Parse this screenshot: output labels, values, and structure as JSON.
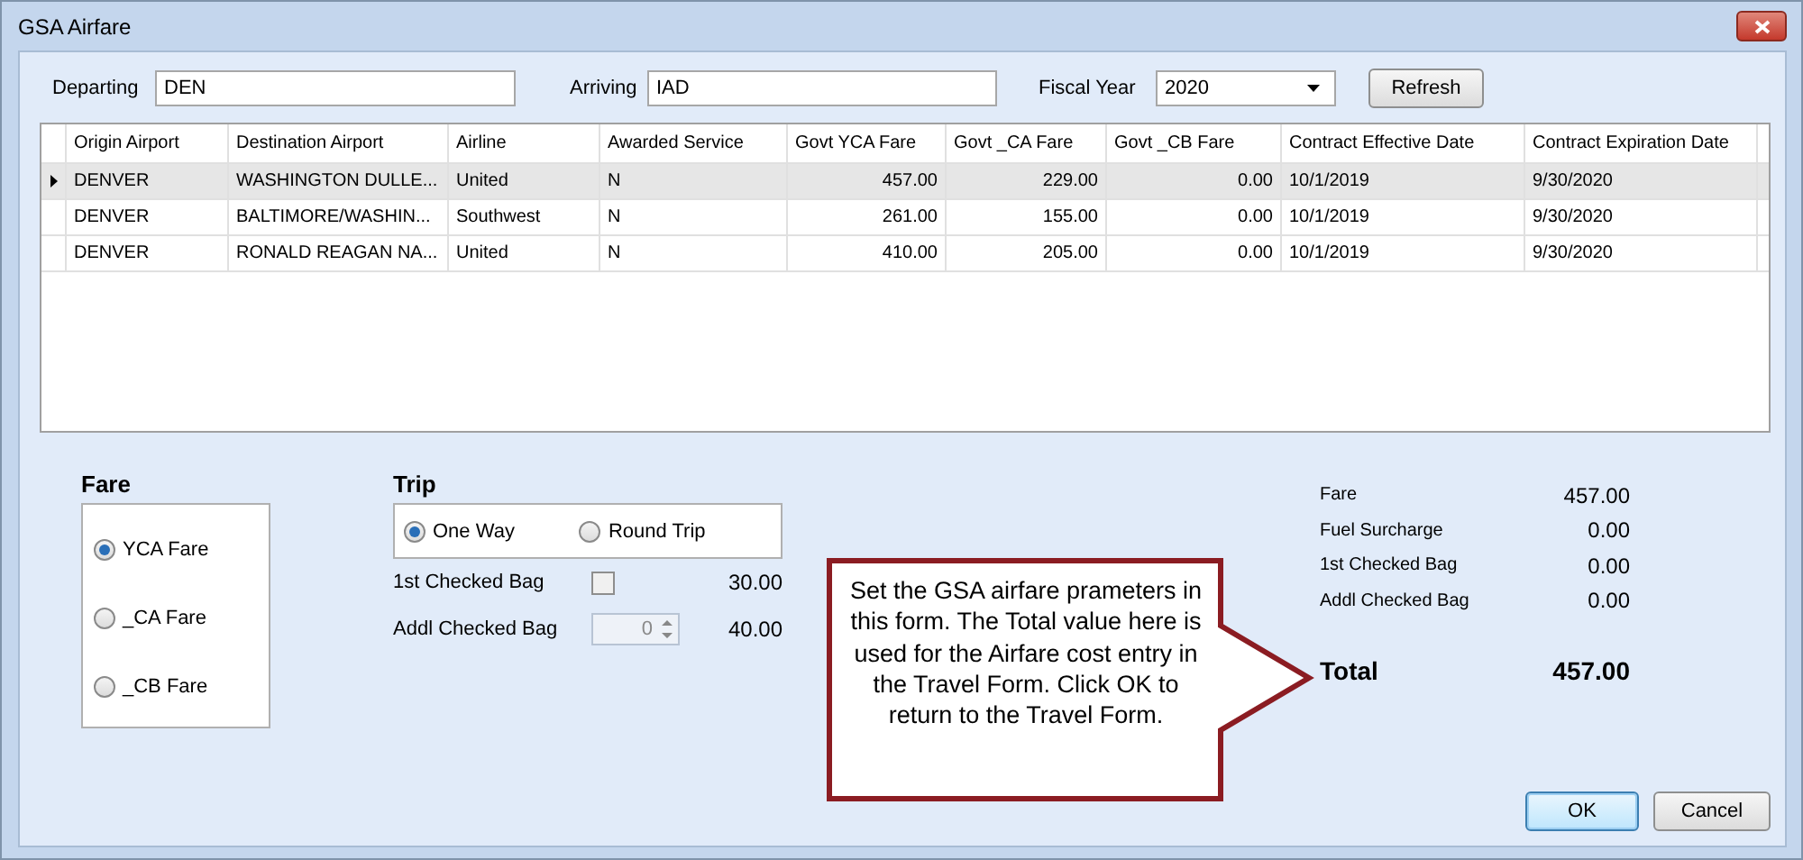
{
  "window": {
    "title": "GSA Airfare"
  },
  "filters": {
    "departing": {
      "label": "Departing",
      "value": "DEN"
    },
    "arriving": {
      "label": "Arriving",
      "value": "IAD"
    },
    "fiscal_year": {
      "label": "Fiscal Year",
      "value": "2020"
    },
    "refresh": "Refresh"
  },
  "table": {
    "columns": [
      {
        "label": "Origin Airport",
        "kind": "text"
      },
      {
        "label": "Destination Airport",
        "kind": "text"
      },
      {
        "label": "Airline",
        "kind": "text"
      },
      {
        "label": "Awarded Service",
        "kind": "text"
      },
      {
        "label": "Govt YCA Fare",
        "kind": "number"
      },
      {
        "label": "Govt _CA Fare",
        "kind": "number"
      },
      {
        "label": "Govt _CB Fare",
        "kind": "number"
      },
      {
        "label": "Contract Effective Date",
        "kind": "text"
      },
      {
        "label": "Contract Expiration Date",
        "kind": "text"
      }
    ],
    "rows": [
      {
        "selected": true,
        "cells": [
          "DENVER",
          "WASHINGTON DULLE...",
          "United",
          "N",
          "457.00",
          "229.00",
          "0.00",
          "10/1/2019",
          "9/30/2020"
        ]
      },
      {
        "selected": false,
        "cells": [
          "DENVER",
          "BALTIMORE/WASHIN...",
          "Southwest",
          "N",
          "261.00",
          "155.00",
          "0.00",
          "10/1/2019",
          "9/30/2020"
        ]
      },
      {
        "selected": false,
        "cells": [
          "DENVER",
          "RONALD REAGAN NA...",
          "United",
          "N",
          "410.00",
          "205.00",
          "0.00",
          "10/1/2019",
          "9/30/2020"
        ]
      }
    ]
  },
  "fare": {
    "title": "Fare",
    "options": [
      {
        "label": "YCA Fare",
        "selected": true
      },
      {
        "label": "_CA Fare",
        "selected": false
      },
      {
        "label": "_CB Fare",
        "selected": false
      }
    ]
  },
  "trip": {
    "title": "Trip",
    "options": [
      {
        "label": "One Way",
        "selected": true
      },
      {
        "label": "Round Trip",
        "selected": false
      }
    ],
    "first_bag": {
      "label": "1st Checked Bag",
      "checked": false,
      "amount": "30.00"
    },
    "addl_bag": {
      "label": "Addl Checked Bag",
      "value": "0",
      "disabled": true,
      "amount": "40.00"
    }
  },
  "summary": {
    "items": [
      {
        "label": "Fare",
        "value": "457.00"
      },
      {
        "label": "Fuel Surcharge",
        "value": "0.00"
      },
      {
        "label": "1st Checked Bag",
        "value": "0.00"
      },
      {
        "label": "Addl Checked Bag",
        "value": "0.00"
      }
    ],
    "total": {
      "label": "Total",
      "value": "457.00"
    }
  },
  "callout": "Set the GSA airfare prameters in this form. The Total value here is used for the Airfare cost entry in the Travel Form. Click OK to return to the Travel Form.",
  "buttons": [
    {
      "label": "OK",
      "focused": true
    },
    {
      "label": "Cancel",
      "focused": false
    }
  ]
}
